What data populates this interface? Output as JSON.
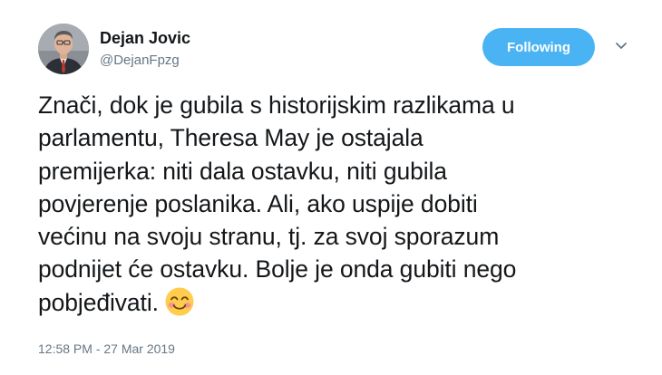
{
  "author": {
    "name": "Dejan Jovic",
    "handle": "@DejanFpzg"
  },
  "follow_button": {
    "label": "Following",
    "color": "#4ab3f4"
  },
  "menu": {
    "icon": "chevron-down-icon"
  },
  "tweet": {
    "lines": [
      "Znači, dok je gubila s historijskim razlikama u",
      "parlamentu, Theresa May je ostajala",
      "premijerka: niti dala ostavku, niti gubila",
      "povjerenje poslanika. Ali, ako uspije dobiti",
      "većinu na svoju stranu, tj. za svoj sporazum",
      "podnijet će ostavku. Bolje je onda gubiti nego",
      "pobjeđivati."
    ],
    "emoji": "smiling-face-with-smiling-eyes-icon"
  },
  "timestamp": "12:58 PM - 27 Mar 2019"
}
